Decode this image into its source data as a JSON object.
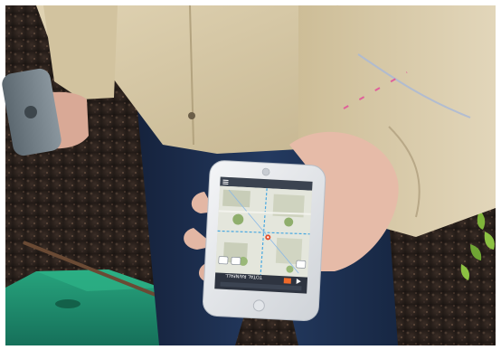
{
  "photo": {
    "description_elements": [
      "person-in-beige-jacket",
      "gray-gps-receiver",
      "smartphone-with-map",
      "green-utility-box",
      "mulch-ground"
    ],
    "colors": {
      "ground": "#2a211c",
      "jacket": "#d8c9a6",
      "jeans": "#1e2f4f",
      "skin": "#e8c2b0",
      "phone_body": "#e9ebee",
      "green_box": "#1e8a6a"
    }
  },
  "phone": {
    "app_bar_label": "",
    "status_label": "TOTAL RAINFALL",
    "icons": [
      "menu-icon",
      "location-pin-icon",
      "layers-icon",
      "play-icon",
      "next-icon"
    ]
  }
}
